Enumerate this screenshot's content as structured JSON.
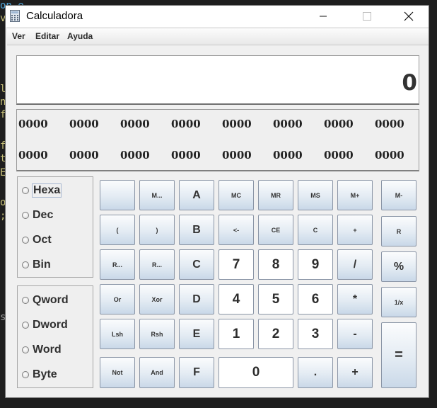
{
  "window": {
    "title": "Calculadora"
  },
  "menu": [
    "Ver",
    "Editar",
    "Ayuda"
  ],
  "display": {
    "value": "0"
  },
  "bits": {
    "row1": [
      "0000",
      "0000",
      "0000",
      "0000",
      "0000",
      "0000",
      "0000",
      "0000"
    ],
    "row2": [
      "0000",
      "0000",
      "0000",
      "0000",
      "0000",
      "0000",
      "0000",
      "0000"
    ]
  },
  "base_options": [
    {
      "label": "Hexa",
      "selected": true
    },
    {
      "label": "Dec",
      "selected": false
    },
    {
      "label": "Oct",
      "selected": false
    },
    {
      "label": "Bin",
      "selected": false
    }
  ],
  "word_options": [
    {
      "label": "Qword",
      "selected": false
    },
    {
      "label": "Dword",
      "selected": false
    },
    {
      "label": "Word",
      "selected": false
    },
    {
      "label": "Byte",
      "selected": false
    }
  ],
  "keys": {
    "blank": "",
    "m_more": "M...",
    "a": "A",
    "mc": "MC",
    "mr": "MR",
    "ms": "MS",
    "m_plus": "M+",
    "m_minus": "M-",
    "lparen": "(",
    "rparen": ")",
    "b": "B",
    "backspace": "<-",
    "ce": "CE",
    "c": "C",
    "plusminus": "+",
    "r": "R",
    "r_more_1": "R...",
    "r_more_2": "R...",
    "c_hex": "C",
    "seven": "7",
    "eight": "8",
    "nine": "9",
    "divide": "/",
    "percent": "%",
    "or": "Or",
    "xor": "Xor",
    "d": "D",
    "four": "4",
    "five": "5",
    "six": "6",
    "multiply": "*",
    "reciprocal": "1/x",
    "lsh": "Lsh",
    "rsh": "Rsh",
    "e": "E",
    "one": "1",
    "two": "2",
    "three": "3",
    "minus": "-",
    "equals": "=",
    "not": "Not",
    "and": "And",
    "f": "F",
    "zero": "0",
    "dot": ".",
    "plus": "+"
  },
  "background_code": [
    "on.e",
    "va",
    "l",
    "no",
    "f",
    "f",
    "ti",
    "E",
    "os",
    ";",
    "s"
  ]
}
